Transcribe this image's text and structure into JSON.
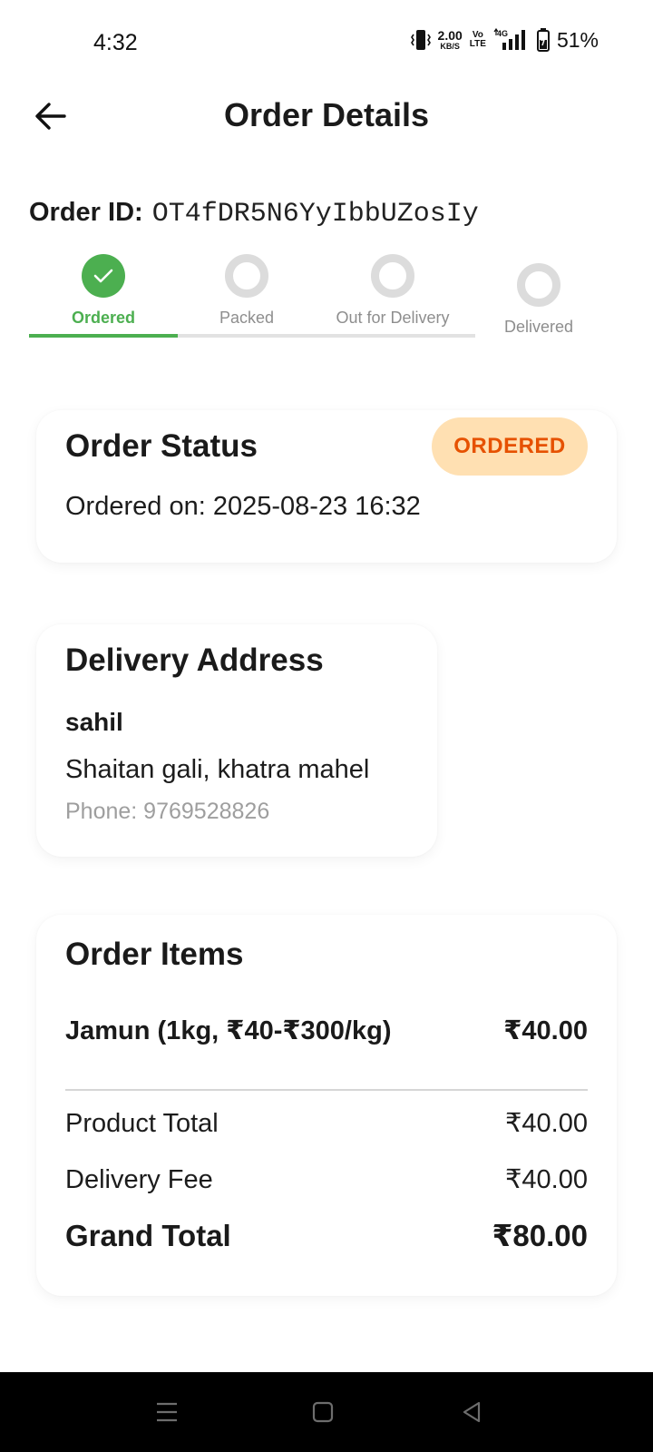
{
  "status_bar": {
    "time": "4:32",
    "net_speed_value": "2.00",
    "net_speed_unit": "KB/S",
    "volte_top": "Vo",
    "volte_bottom": "LTE",
    "network_type": "4G",
    "battery_percent": "51%",
    "icons": [
      "vibrate-icon",
      "signal-icon",
      "battery-charging-icon"
    ]
  },
  "header": {
    "title": "Order Details",
    "back_icon": "arrow-left-icon"
  },
  "order": {
    "id_label": "Order ID:",
    "id_value": "OT4fDR5N6YyIbbUZosIy"
  },
  "stepper": {
    "steps": [
      {
        "label": "Ordered",
        "state": "done"
      },
      {
        "label": "Packed",
        "state": "pending"
      },
      {
        "label": "Out for Delivery",
        "state": "pending"
      },
      {
        "label": "Delivered",
        "state": "pending"
      }
    ],
    "active_color": "#4caf50",
    "inactive_color": "#dcdcdc"
  },
  "status_card": {
    "title": "Order Status",
    "badge": "ORDERED",
    "badge_bg": "#ffe0b2",
    "badge_color": "#e65100",
    "ordered_on": "Ordered on: 2025-08-23 16:32"
  },
  "address_card": {
    "title": "Delivery Address",
    "name": "sahil",
    "line": "Shaitan gali, khatra mahel",
    "phone": "Phone: 9769528826"
  },
  "items_card": {
    "title": "Order Items",
    "items": [
      {
        "name": "Jamun (1kg, ₹40-₹300/kg)",
        "price": "₹40.00"
      }
    ],
    "product_total_label": "Product Total",
    "product_total_value": "₹40.00",
    "delivery_fee_label": "Delivery Fee",
    "delivery_fee_value": "₹40.00",
    "grand_total_label": "Grand Total",
    "grand_total_value": "₹80.00"
  },
  "nav_bar": {
    "buttons": [
      "menu-icon",
      "home-square-icon",
      "back-triangle-icon"
    ]
  }
}
